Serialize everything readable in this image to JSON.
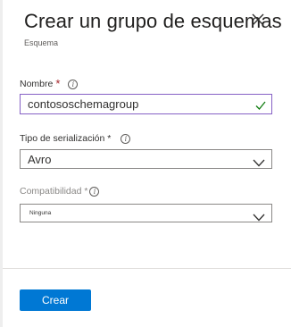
{
  "panel": {
    "title": "Crear un grupo de esquemas",
    "subtitle": "Esquema",
    "close_icon": "close-icon"
  },
  "form": {
    "name": {
      "label": "Nombre",
      "required_mark": "*",
      "value": "contososchemagroup",
      "valid": true,
      "accent_color": "#8661c5",
      "valid_color": "#107c10"
    },
    "serialization": {
      "label": "Tipo de serialización *",
      "selected": "Avro"
    },
    "compatibility": {
      "label": "Compatibilidad *",
      "selected": "Ninguna",
      "disabled": true
    }
  },
  "footer": {
    "create_label": "Crear",
    "primary_color": "#0078d4"
  }
}
